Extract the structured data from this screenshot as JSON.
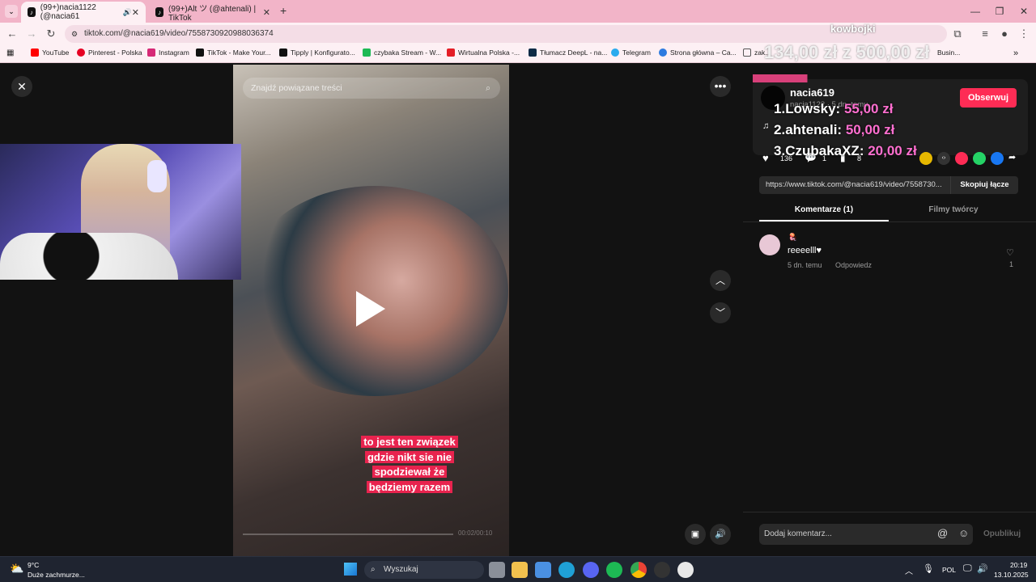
{
  "tabs": [
    {
      "label": "(99+)nacia1122 (@nacia61"
    },
    {
      "label": "(99+)Alt ツ (@ahtenali) | TikTok"
    }
  ],
  "address": "tiktok.com/@nacia619/video/7558730920988036374",
  "bookmarks": [
    "YouTube",
    "Pinterest - Polska",
    "Instagram",
    "TikTok - Make Your...",
    "Tipply | Konfigurato...",
    "czybaka Stream - W...",
    "Wirtualna Polska -...",
    "Tłumacz DeepL - na...",
    "Telegram",
    "Strona główna – Ca...",
    "zak...",
    " Busin..."
  ],
  "colors": {
    "tab_strip": "#f2b4c8",
    "follow": "#fe2c55",
    "donation_pink": "#ff6fd0"
  },
  "overlay": {
    "brand": "kowbojki",
    "goal": "134,00 zł  z  500,00 zł",
    "ranking": [
      {
        "rank": "1.",
        "name": "Lowsky:",
        "amount": "55,00 zł"
      },
      {
        "rank": "2.",
        "name": "ahtenali:",
        "amount": "50,00 zł"
      },
      {
        "rank": "3.",
        "name": "CzubakaXZ:",
        "amount": "20,00 zł"
      }
    ]
  },
  "video": {
    "search_placeholder": "Znajdź powiązane treści",
    "caption_lines": [
      "to jest ten związek",
      "gdzie nikt sie nie",
      "spodziewał że",
      "będziemy razem"
    ],
    "time": "00:02/00:10"
  },
  "panel": {
    "username": "nacia619",
    "subline": "nacia1122 · 5 dn. temu",
    "follow_label": "Obserwuj",
    "music": "♫",
    "likes": "136",
    "comments_count": "1",
    "saves": "8",
    "link": "https://www.tiktok.com/@nacia619/video/7558730...",
    "copy_label": "Skopiuj łącze",
    "tab_comments": "Komentarze (1)",
    "tab_creator": "Filmy twórcy",
    "comment": {
      "author_badge": "🪼",
      "text": "reeeelll♥",
      "time": "5 dn. temu",
      "reply": "Odpowiedz",
      "likes": "1"
    },
    "add_comment_placeholder": "Dodaj komentarz...",
    "publish_label": "Opublikuj"
  },
  "taskbar": {
    "temp": "9°C",
    "weather": "Duże zachmurze...",
    "search": "Wyszukaj",
    "lang": "POL",
    "time": "20:19",
    "date": "13.10.2025"
  }
}
